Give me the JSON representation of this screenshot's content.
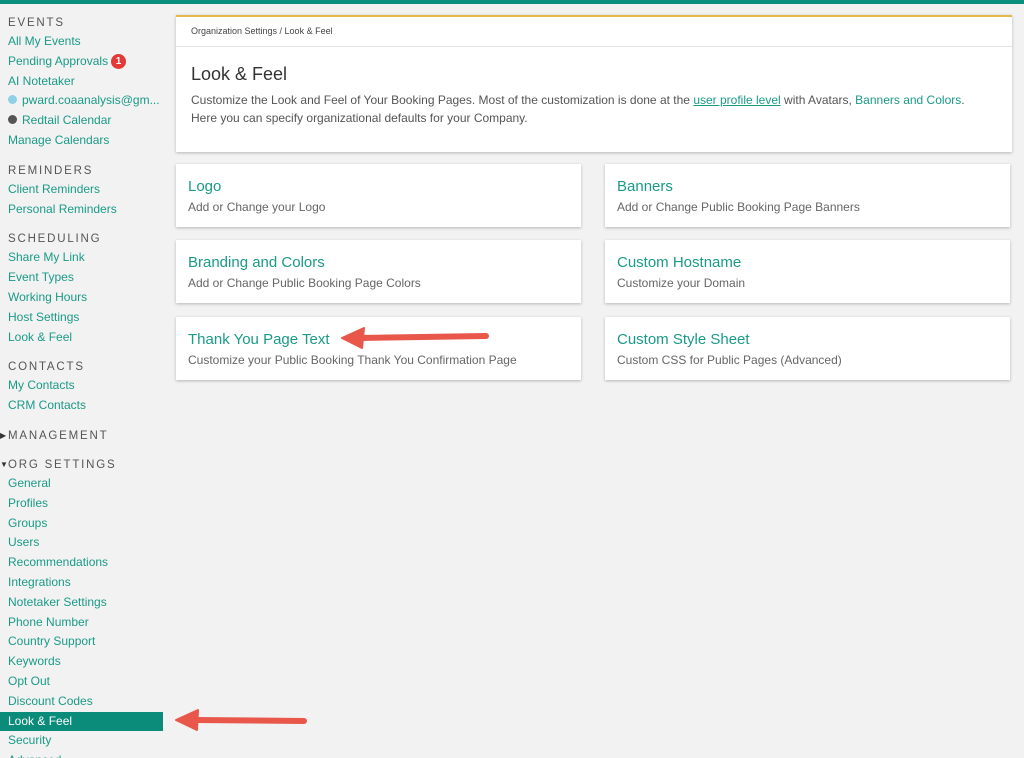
{
  "sidebar": {
    "sections": [
      {
        "header": "EVENTS",
        "items": [
          {
            "label": "All My Events"
          },
          {
            "label": "Pending Approvals",
            "badge": "1"
          },
          {
            "label": "AI Notetaker"
          },
          {
            "label": "pward.coaanalysis@gm...",
            "dot": "light"
          },
          {
            "label": "Redtail Calendar",
            "dot": "dark"
          },
          {
            "label": "Manage Calendars"
          }
        ]
      },
      {
        "header": "REMINDERS",
        "items": [
          {
            "label": "Client Reminders"
          },
          {
            "label": "Personal Reminders"
          }
        ]
      },
      {
        "header": "SCHEDULING",
        "items": [
          {
            "label": "Share My Link"
          },
          {
            "label": "Event Types"
          },
          {
            "label": "Working Hours"
          },
          {
            "label": "Host Settings"
          },
          {
            "label": "Look & Feel"
          }
        ]
      },
      {
        "header": "CONTACTS",
        "items": [
          {
            "label": "My Contacts"
          },
          {
            "label": "CRM Contacts"
          }
        ]
      },
      {
        "header": "MANAGEMENT",
        "caret": "▶",
        "items": []
      },
      {
        "header": "ORG SETTINGS",
        "caret": "▼",
        "items": [
          {
            "label": "General"
          },
          {
            "label": "Profiles"
          },
          {
            "label": "Groups"
          },
          {
            "label": "Users"
          },
          {
            "label": "Recommendations"
          },
          {
            "label": "Integrations"
          },
          {
            "label": "Notetaker Settings"
          },
          {
            "label": "Phone Number"
          },
          {
            "label": "Country Support"
          },
          {
            "label": "Keywords"
          },
          {
            "label": "Opt Out"
          },
          {
            "label": "Discount Codes"
          },
          {
            "label": "Look & Feel",
            "active": true
          },
          {
            "label": "Security"
          },
          {
            "label": "Advanced"
          }
        ]
      }
    ]
  },
  "header": {
    "breadcrumb": "Organization Settings / Look & Feel",
    "title": "Look & Feel",
    "desc_part1": "Customize the Look and Feel of Your Booking Pages. Most of the customization is done at the ",
    "link1": "user profile level",
    "desc_part2": " with Avatars, ",
    "link2": "Banners and Colors",
    "desc_part3": ".",
    "desc_line2": "Here you can specify organizational defaults for your Company."
  },
  "cards": [
    {
      "title": "Logo",
      "desc": "Add or Change your Logo"
    },
    {
      "title": "Banners",
      "desc": "Add or Change Public Booking Page Banners"
    },
    {
      "title": "Branding and Colors",
      "desc": "Add or Change Public Booking Page Colors"
    },
    {
      "title": "Custom Hostname",
      "desc": "Customize your Domain"
    },
    {
      "title": "Thank You Page Text",
      "desc": "Customize your Public Booking Thank You Confirmation Page"
    },
    {
      "title": "Custom Style Sheet",
      "desc": "Custom CSS for Public Pages (Advanced)"
    }
  ],
  "colors": {
    "accent": "#1a9a88",
    "topbar": "#0a8f7e",
    "active_bg": "#0b8b7a",
    "header_border": "#e6b84a",
    "badge": "#e53935",
    "annotation_arrow": "#e8574a"
  },
  "annotations": [
    {
      "icon": "arrow-left-icon",
      "target": "Thank You Page Text"
    },
    {
      "icon": "arrow-left-icon",
      "target": "Look & Feel"
    }
  ]
}
